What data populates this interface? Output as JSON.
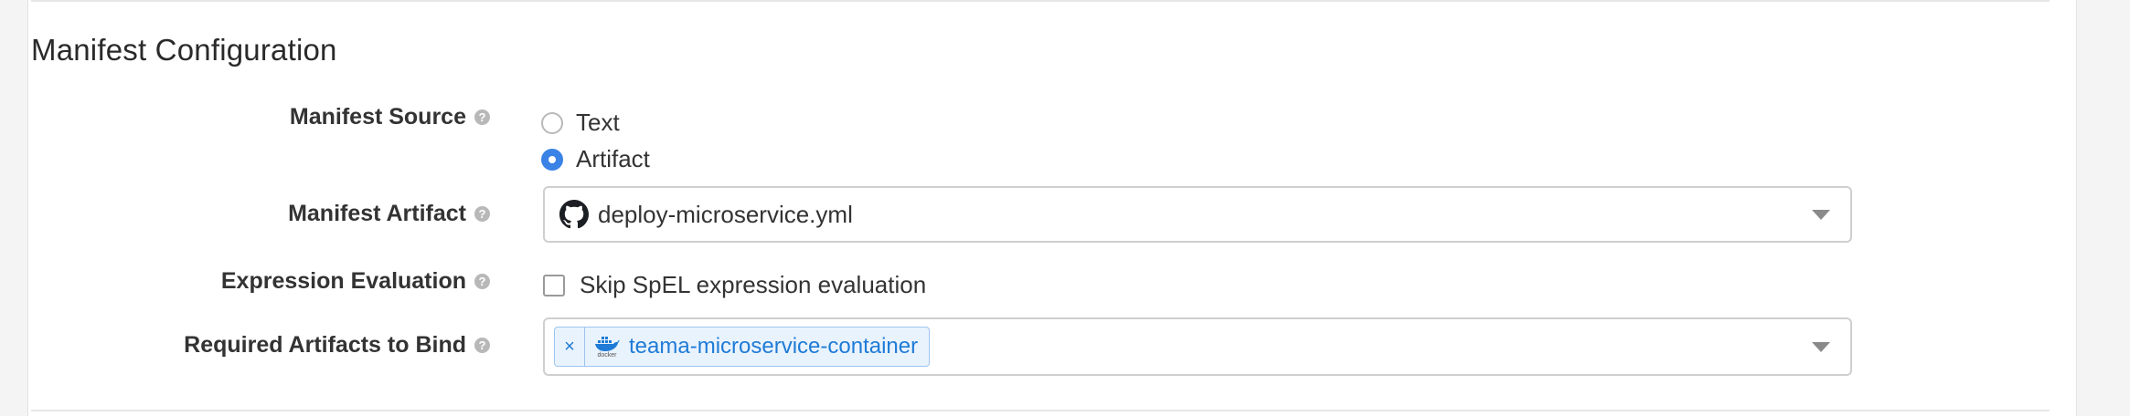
{
  "section": {
    "title": "Manifest Configuration"
  },
  "help_glyph": "?",
  "manifest_source": {
    "label": "Manifest Source",
    "options": [
      {
        "label": "Text",
        "selected": false
      },
      {
        "label": "Artifact",
        "selected": true
      }
    ]
  },
  "manifest_artifact": {
    "label": "Manifest Artifact",
    "value": "deploy-microservice.yml",
    "icon": "github-icon"
  },
  "expression_evaluation": {
    "label": "Expression Evaluation",
    "checkbox_label": "Skip SpEL expression evaluation",
    "checked": false
  },
  "required_artifacts": {
    "label": "Required Artifacts to Bind",
    "tags": [
      {
        "remove_glyph": "×",
        "icon": "docker-icon",
        "icon_caption": "docker",
        "text": "teama-microservice-container"
      }
    ]
  },
  "colors": {
    "accent": "#3b82e6",
    "tag_text": "#1f7bd6",
    "tag_bg": "#e9f3fd"
  }
}
